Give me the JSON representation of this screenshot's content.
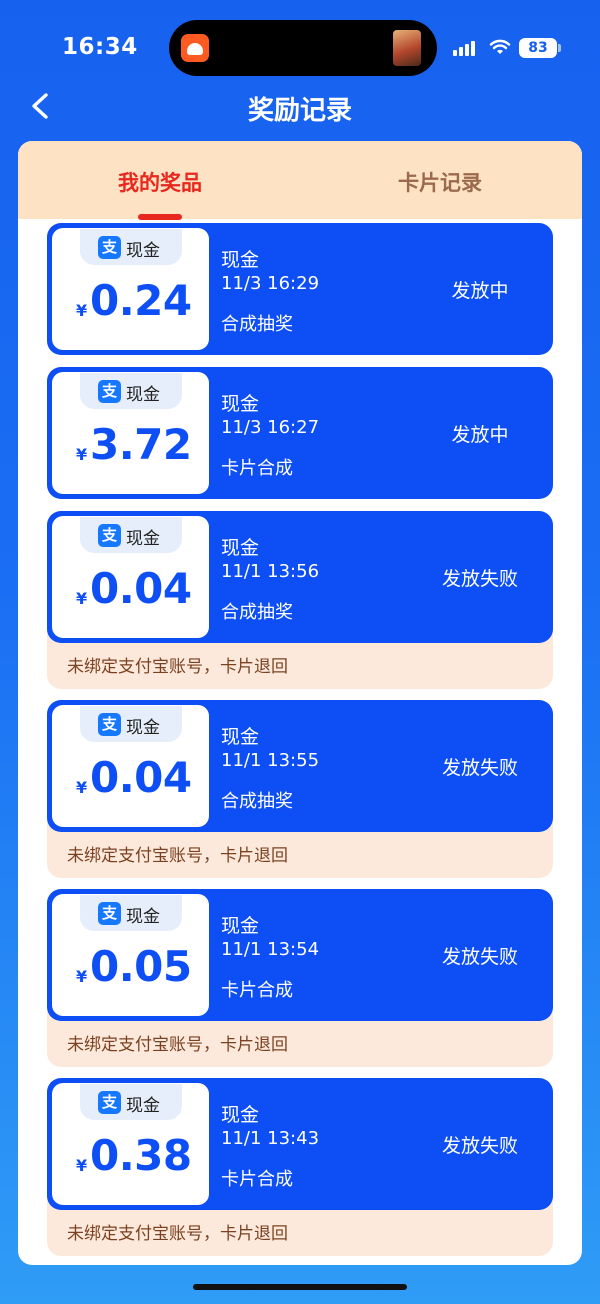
{
  "status_bar": {
    "time": "16:34",
    "battery": "83"
  },
  "header": {
    "title": "奖励记录"
  },
  "tabs": [
    {
      "label": "我的奖品",
      "active": true
    },
    {
      "label": "卡片记录",
      "active": false
    }
  ],
  "records": [
    {
      "badge": "现金",
      "currency": "¥",
      "amount": "0.24",
      "type": "现金",
      "time": "11/3 16:29",
      "source": "合成抽奖",
      "status": "发放中"
    },
    {
      "badge": "现金",
      "currency": "¥",
      "amount": "3.72",
      "type": "现金",
      "time": "11/3 16:27",
      "source": "卡片合成",
      "status": "发放中"
    },
    {
      "badge": "现金",
      "currency": "¥",
      "amount": "0.04",
      "type": "现金",
      "time": "11/1 13:56",
      "source": "合成抽奖",
      "status": "发放失败",
      "note": "未绑定支付宝账号，卡片退回"
    },
    {
      "badge": "现金",
      "currency": "¥",
      "amount": "0.04",
      "type": "现金",
      "time": "11/1 13:55",
      "source": "合成抽奖",
      "status": "发放失败",
      "note": "未绑定支付宝账号，卡片退回"
    },
    {
      "badge": "现金",
      "currency": "¥",
      "amount": "0.05",
      "type": "现金",
      "time": "11/1 13:54",
      "source": "卡片合成",
      "status": "发放失败",
      "note": "未绑定支付宝账号，卡片退回"
    },
    {
      "badge": "现金",
      "currency": "¥",
      "amount": "0.38",
      "type": "现金",
      "time": "11/1 13:43",
      "source": "卡片合成",
      "status": "发放失败",
      "note": "未绑定支付宝账号，卡片退回"
    }
  ],
  "alipay_glyph": "支",
  "colors": {
    "primary": "#0d4ff5",
    "tab_active": "#e8271f",
    "tab_bg": "#fde3c3",
    "note_bg": "#fde9dc"
  }
}
